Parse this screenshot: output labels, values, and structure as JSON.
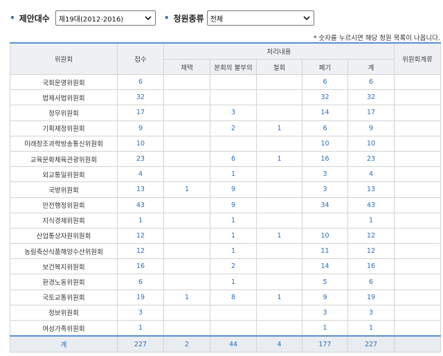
{
  "filters": {
    "session_label": "제안대수",
    "session_value": "제19대(2012-2016)",
    "type_label": "청원종류",
    "type_value": "전체"
  },
  "note": "* 숫자를 누르시면 해당 청원 목록이 나옵니다.",
  "headers": {
    "committee": "위원회",
    "received": "접수",
    "processing": "처리내용",
    "adopted": "채택",
    "not_referred": "본회의 불부의",
    "withdrawn": "철회",
    "discarded": "폐기",
    "total": "계",
    "pending": "위원회계류"
  },
  "rows": [
    {
      "name": "국회운영위원회",
      "received": "6",
      "adopted": "",
      "not_referred": "",
      "withdrawn": "",
      "discarded": "6",
      "total": "6",
      "pending": ""
    },
    {
      "name": "법제사법위원회",
      "received": "32",
      "adopted": "",
      "not_referred": "",
      "withdrawn": "",
      "discarded": "32",
      "total": "32",
      "pending": ""
    },
    {
      "name": "정무위원회",
      "received": "17",
      "adopted": "",
      "not_referred": "3",
      "withdrawn": "",
      "discarded": "14",
      "total": "17",
      "pending": ""
    },
    {
      "name": "기획재정위원회",
      "received": "9",
      "adopted": "",
      "not_referred": "2",
      "withdrawn": "1",
      "discarded": "6",
      "total": "9",
      "pending": ""
    },
    {
      "name": "미래창조과학방송통신위원회",
      "received": "10",
      "adopted": "",
      "not_referred": "",
      "withdrawn": "",
      "discarded": "10",
      "total": "10",
      "pending": ""
    },
    {
      "name": "교육문화체육관광위원회",
      "received": "23",
      "adopted": "",
      "not_referred": "6",
      "withdrawn": "1",
      "discarded": "16",
      "total": "23",
      "pending": ""
    },
    {
      "name": "외교통일위원회",
      "received": "4",
      "adopted": "",
      "not_referred": "1",
      "withdrawn": "",
      "discarded": "3",
      "total": "4",
      "pending": ""
    },
    {
      "name": "국방위원회",
      "received": "13",
      "adopted": "1",
      "not_referred": "9",
      "withdrawn": "",
      "discarded": "3",
      "total": "13",
      "pending": ""
    },
    {
      "name": "안전행정위원회",
      "received": "43",
      "adopted": "",
      "not_referred": "9",
      "withdrawn": "",
      "discarded": "34",
      "total": "43",
      "pending": ""
    },
    {
      "name": "지식경제위원회",
      "received": "1",
      "adopted": "",
      "not_referred": "1",
      "withdrawn": "",
      "discarded": "",
      "total": "1",
      "pending": ""
    },
    {
      "name": "산업통상자원위원회",
      "received": "12",
      "adopted": "",
      "not_referred": "1",
      "withdrawn": "1",
      "discarded": "10",
      "total": "12",
      "pending": ""
    },
    {
      "name": "농림축산식품해양수산위원회",
      "received": "12",
      "adopted": "",
      "not_referred": "1",
      "withdrawn": "",
      "discarded": "11",
      "total": "12",
      "pending": ""
    },
    {
      "name": "보건복지위원회",
      "received": "16",
      "adopted": "",
      "not_referred": "2",
      "withdrawn": "",
      "discarded": "14",
      "total": "16",
      "pending": ""
    },
    {
      "name": "환경노동위원회",
      "received": "6",
      "adopted": "",
      "not_referred": "1",
      "withdrawn": "",
      "discarded": "5",
      "total": "6",
      "pending": ""
    },
    {
      "name": "국토교통위원회",
      "received": "19",
      "adopted": "1",
      "not_referred": "8",
      "withdrawn": "1",
      "discarded": "9",
      "total": "19",
      "pending": ""
    },
    {
      "name": "정보위원회",
      "received": "3",
      "adopted": "",
      "not_referred": "",
      "withdrawn": "",
      "discarded": "3",
      "total": "3",
      "pending": ""
    },
    {
      "name": "여성가족위원회",
      "received": "1",
      "adopted": "",
      "not_referred": "",
      "withdrawn": "",
      "discarded": "1",
      "total": "1",
      "pending": ""
    }
  ],
  "totals": {
    "name": "계",
    "received": "227",
    "adopted": "2",
    "not_referred": "44",
    "withdrawn": "4",
    "discarded": "177",
    "total": "227",
    "pending": ""
  },
  "colors": {
    "accent": "#2a6ebb",
    "header_bg": "#eef0f3"
  }
}
